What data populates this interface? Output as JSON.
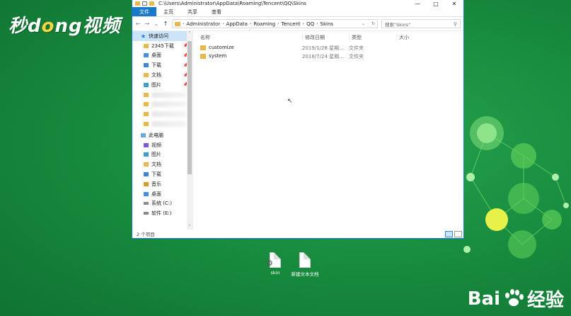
{
  "watermark_top": {
    "part1": "秒",
    "part2": "d",
    "part3": "o",
    "part4": "ng视频"
  },
  "watermark_bottom": {
    "brand": "Bai",
    "suffix": "经验"
  },
  "window": {
    "title_path": "C:\\Users\\Administrator\\AppData\\Roaming\\Tencent\\QQ\\Skins",
    "controls": {
      "minimize": "—",
      "maximize": "□",
      "close": "✕"
    }
  },
  "ribbon": {
    "tabs": [
      "文件",
      "主页",
      "共享",
      "查看"
    ]
  },
  "address": {
    "crumbs": [
      "Administrator",
      "AppData",
      "Roaming",
      "Tencent",
      "QQ",
      "Skins"
    ],
    "search_placeholder": "搜索\"Skins\""
  },
  "nav": {
    "quick_access": "快速访问",
    "pinned": [
      "2345下载",
      "桌面",
      "下载",
      "文档",
      "图片"
    ],
    "this_pc": "此电脑",
    "pc_items": [
      "视频",
      "图片",
      "文档",
      "下载",
      "音乐",
      "桌面",
      "系统 (C:)",
      "软件 (E:)"
    ]
  },
  "columns": {
    "name": "名称",
    "date": "修改日期",
    "type": "类型",
    "size": "大小"
  },
  "files": [
    {
      "name": "customize",
      "date": "2019/1/28 星期...",
      "type": "文件夹"
    },
    {
      "name": "system",
      "date": "2018/7/24 星期...",
      "type": "文件夹"
    }
  ],
  "status": {
    "count": "2 个项目"
  },
  "desktop": {
    "icon1": "skin",
    "icon2": "新建文本文档"
  },
  "colors": {
    "accent": "#1979ca",
    "background": "#17893d",
    "folder": "#e8b84a"
  }
}
